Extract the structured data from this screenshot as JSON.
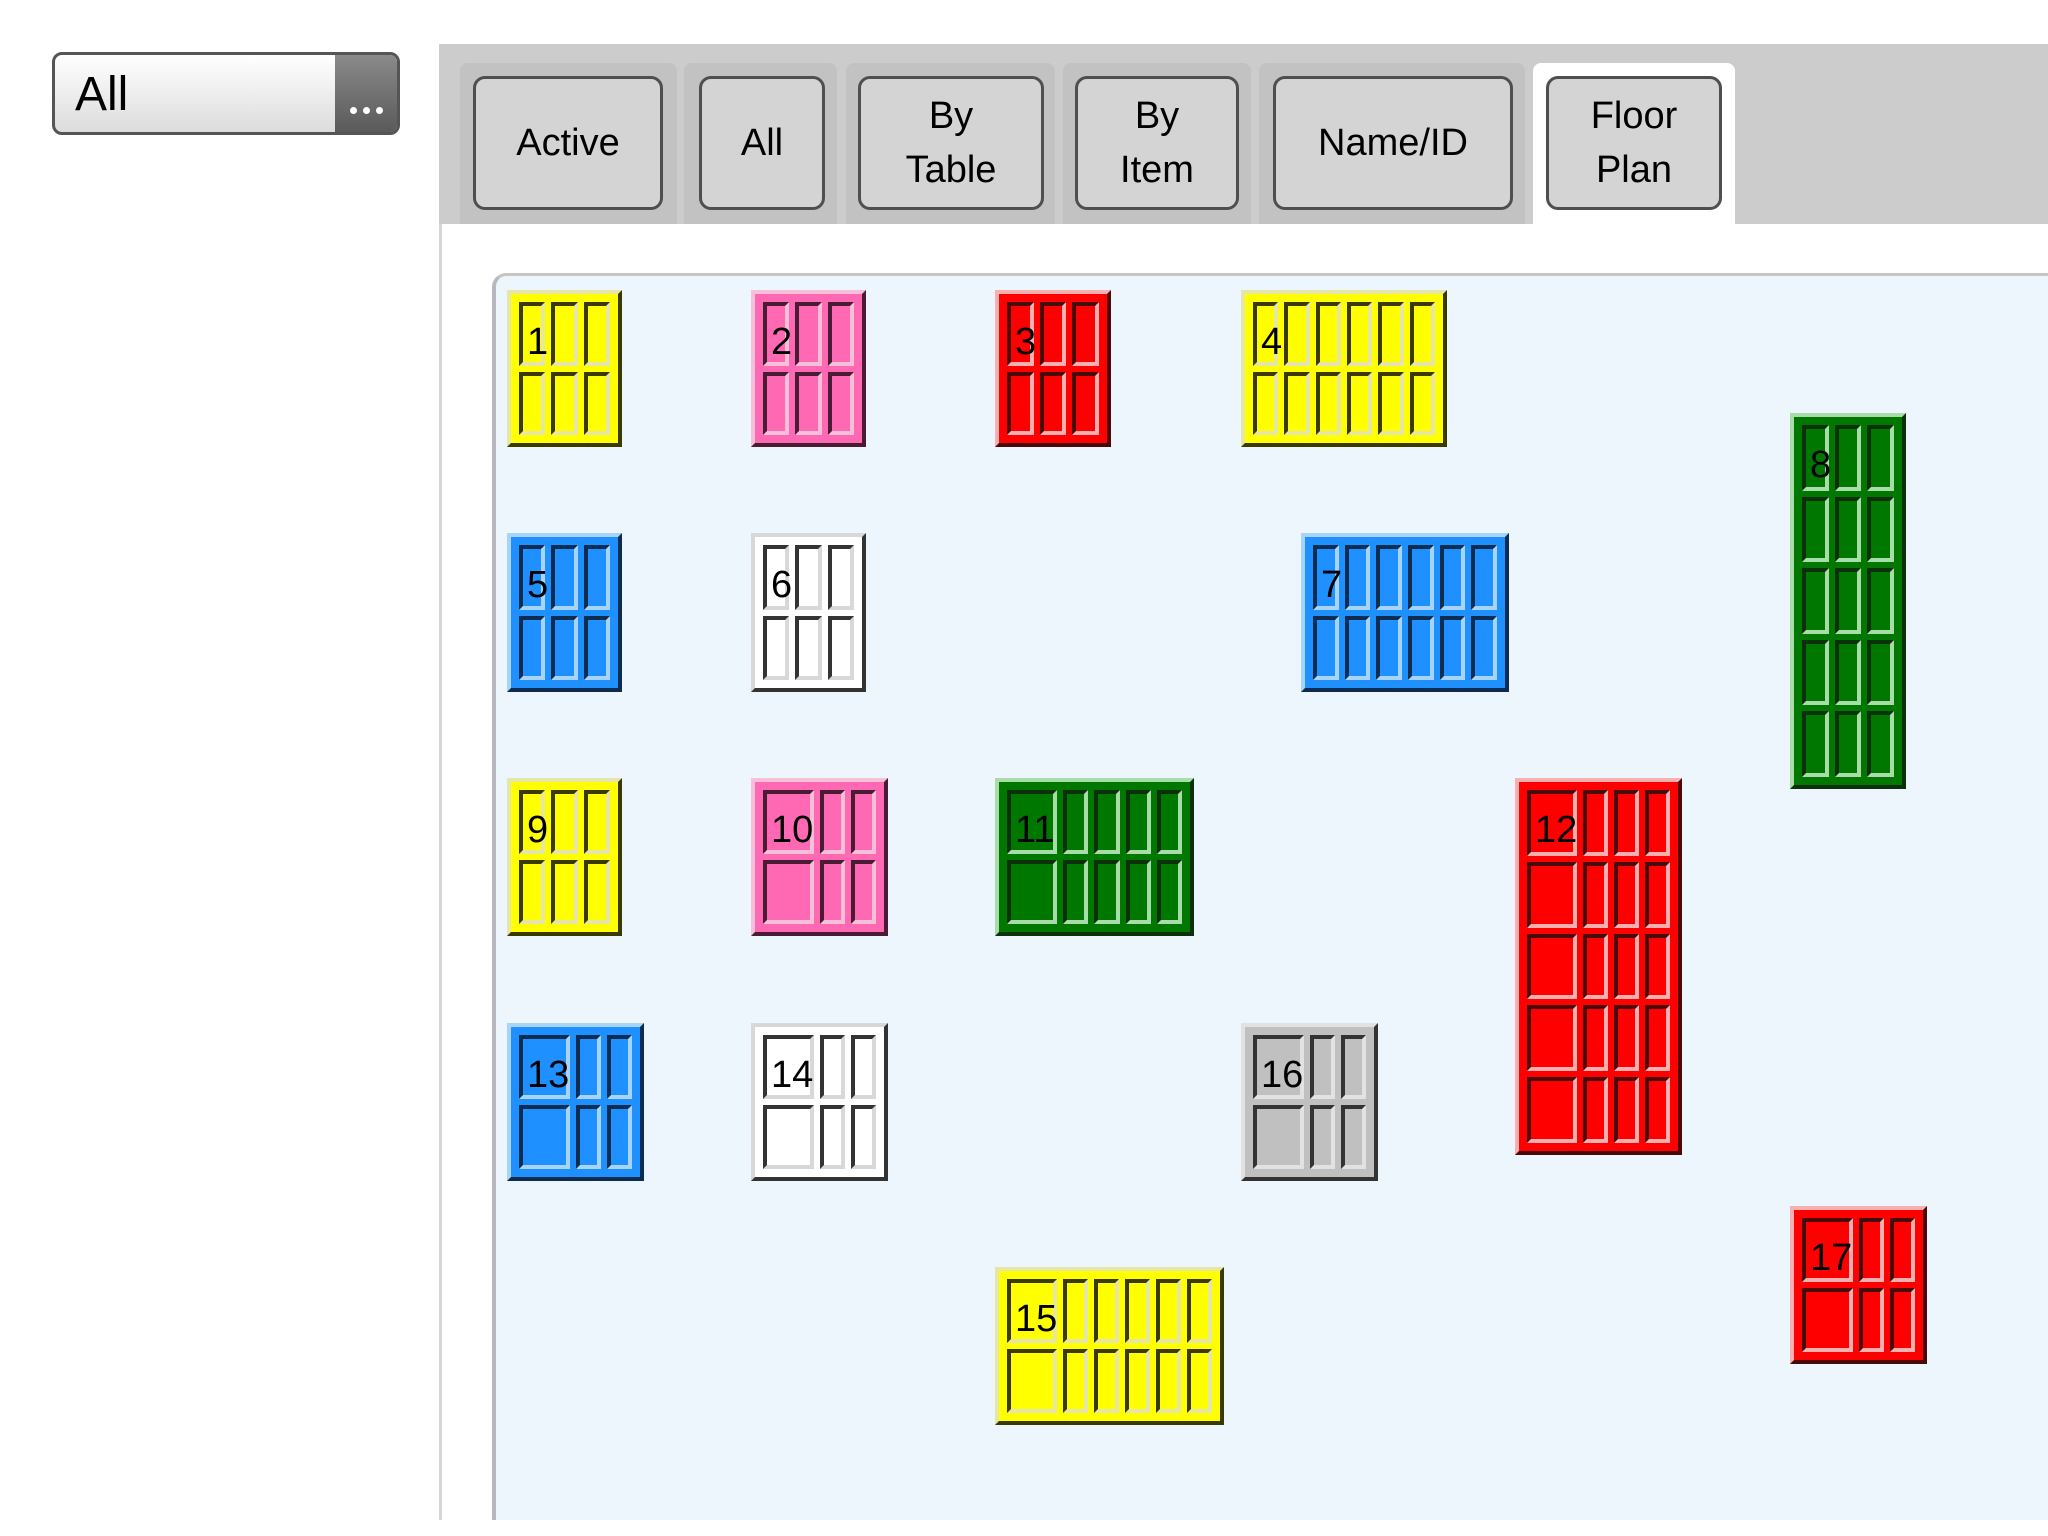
{
  "filter": {
    "value": "All",
    "more_icon": "ellipsis-icon"
  },
  "tabs": [
    {
      "label": "Active",
      "selected": false
    },
    {
      "label": "All",
      "selected": false
    },
    {
      "label": "By\nTable",
      "selected": false
    },
    {
      "label": "By\nItem",
      "selected": false
    },
    {
      "label": "Name/ID",
      "selected": false
    },
    {
      "label": "Floor\nPlan",
      "selected": true
    }
  ],
  "floor_plan": {
    "colors": {
      "yellow": "#ffff00",
      "pink": "#ff69b4",
      "red": "#ff0000",
      "blue": "#1e90ff",
      "white": "#ffffff",
      "green": "#007800",
      "gray": "#c0c0c0"
    },
    "tables": [
      {
        "number": "1",
        "color": "yellow",
        "cols": 3,
        "rows": 2,
        "wide_first": false
      },
      {
        "number": "2",
        "color": "pink",
        "cols": 3,
        "rows": 2,
        "wide_first": false
      },
      {
        "number": "3",
        "color": "red",
        "cols": 3,
        "rows": 2,
        "wide_first": false
      },
      {
        "number": "4",
        "color": "yellow",
        "cols": 6,
        "rows": 2,
        "wide_first": false
      },
      {
        "number": "5",
        "color": "blue",
        "cols": 3,
        "rows": 2,
        "wide_first": false
      },
      {
        "number": "6",
        "color": "white",
        "cols": 3,
        "rows": 2,
        "wide_first": false
      },
      {
        "number": "7",
        "color": "blue",
        "cols": 6,
        "rows": 2,
        "wide_first": false
      },
      {
        "number": "8",
        "color": "green",
        "cols": 3,
        "rows": 5,
        "wide_first": false
      },
      {
        "number": "9",
        "color": "yellow",
        "cols": 3,
        "rows": 2,
        "wide_first": false
      },
      {
        "number": "10",
        "color": "pink",
        "cols": 3,
        "rows": 2,
        "wide_first": true
      },
      {
        "number": "11",
        "color": "green",
        "cols": 5,
        "rows": 2,
        "wide_first": true
      },
      {
        "number": "12",
        "color": "red",
        "cols": 4,
        "rows": 5,
        "wide_first": true
      },
      {
        "number": "13",
        "color": "blue",
        "cols": 3,
        "rows": 2,
        "wide_first": true
      },
      {
        "number": "14",
        "color": "white",
        "cols": 3,
        "rows": 2,
        "wide_first": true
      },
      {
        "number": "15",
        "color": "yellow",
        "cols": 6,
        "rows": 2,
        "wide_first": true
      },
      {
        "number": "16",
        "color": "gray",
        "cols": 3,
        "rows": 2,
        "wide_first": true
      },
      {
        "number": "17",
        "color": "red",
        "cols": 3,
        "rows": 2,
        "wide_first": true
      }
    ]
  }
}
